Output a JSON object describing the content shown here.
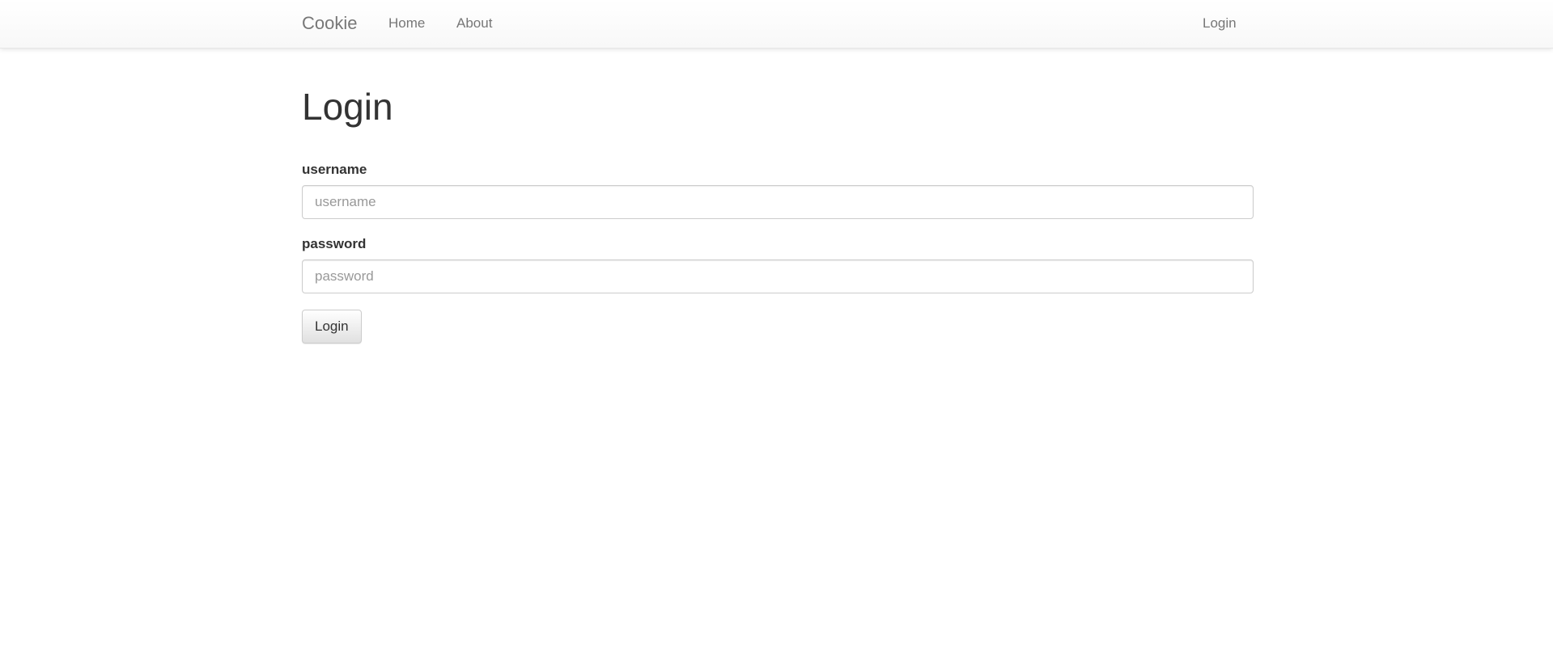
{
  "navbar": {
    "brand": "Cookie",
    "links": [
      {
        "label": "Home"
      },
      {
        "label": "About"
      }
    ],
    "right_link": "Login"
  },
  "main": {
    "title": "Login",
    "username": {
      "label": "username",
      "placeholder": "username",
      "value": ""
    },
    "password": {
      "label": "password",
      "placeholder": "password",
      "value": ""
    },
    "submit_label": "Login"
  }
}
